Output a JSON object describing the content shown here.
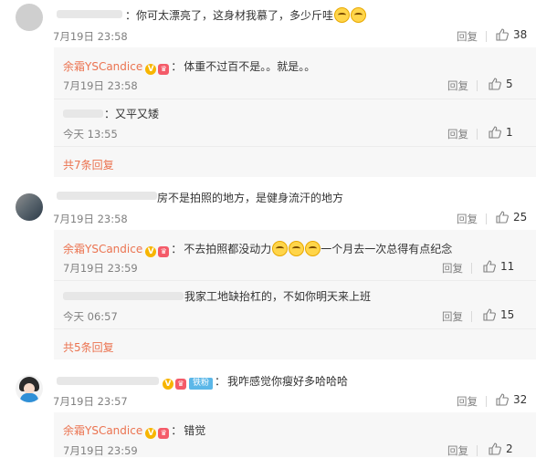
{
  "comments": [
    {
      "text": "你可太漂亮了，这身材我慕了，多少斤哇",
      "time": "7月19日 23:58",
      "reply_label": "回复",
      "likes": "38",
      "replies": [
        {
          "name": "余霜YSCandice",
          "text": "体重不过百不是。。就是。。",
          "time": "7月19日 23:58",
          "reply_label": "回复",
          "likes": "5"
        },
        {
          "text": "又平又矮",
          "time": "今天 13:55",
          "reply_label": "回复",
          "likes": "1"
        }
      ],
      "more": "共7条回复"
    },
    {
      "text": "房不是拍照的地方，是健身流汗的地方",
      "time": "7月19日 23:58",
      "reply_label": "回复",
      "likes": "25",
      "replies": [
        {
          "name": "余霜YSCandice",
          "text_before": "不去拍照都没动力",
          "text_after": "一个月去一次总得有点纪念",
          "time": "7月19日 23:59",
          "reply_label": "回复",
          "likes": "11"
        },
        {
          "text": "我家工地缺抬杠的，不如你明天来上班",
          "time": "今天 06:57",
          "reply_label": "回复",
          "likes": "15"
        }
      ],
      "more": "共5条回复"
    },
    {
      "fan_badge": "铁粉",
      "text": "我咋感觉你瘦好多哈哈哈",
      "time": "7月19日 23:57",
      "reply_label": "回复",
      "likes": "32",
      "replies": [
        {
          "name": "余霜YSCandice",
          "text": "错觉",
          "time": "7月19日 23:59",
          "reply_label": "回复",
          "likes": "2"
        }
      ]
    }
  ],
  "colors": {
    "name": "#eb7350",
    "badge_v": "#f7b500",
    "fan_badge": "#5bb7e8"
  },
  "icons": {
    "like": "thumbs-up-icon",
    "verified": "verified-v-icon"
  }
}
